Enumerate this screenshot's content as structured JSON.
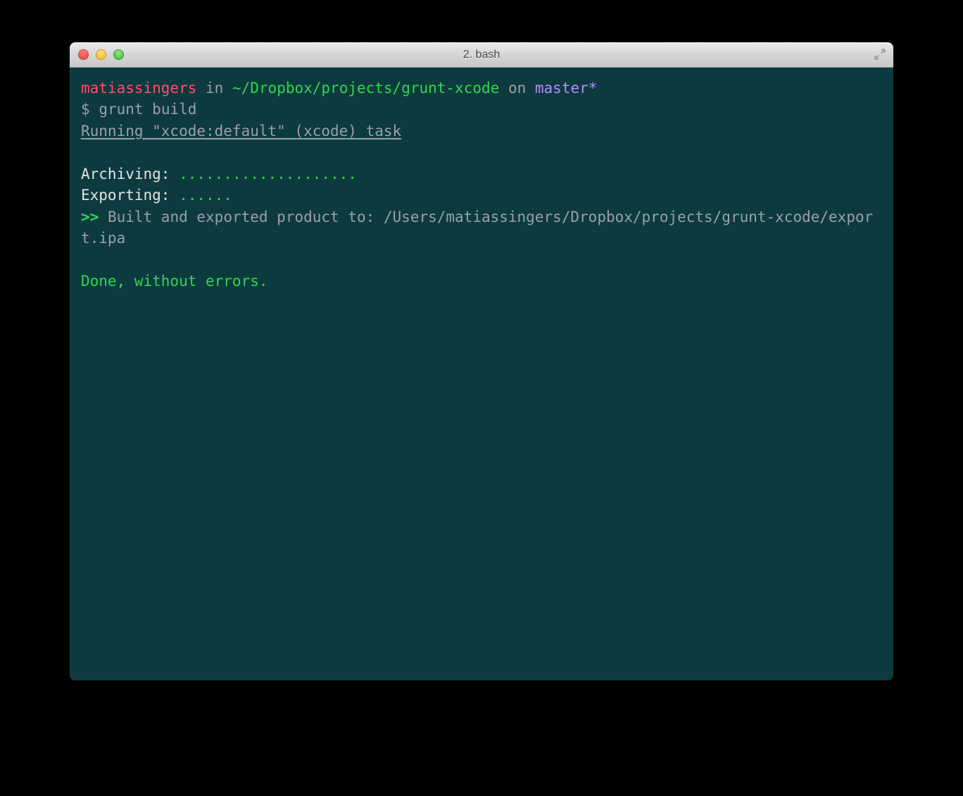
{
  "window": {
    "title": "2. bash"
  },
  "prompt": {
    "user": "matiassingers",
    "in_word": "in",
    "path": "~/Dropbox/projects/grunt-xcode",
    "on_word": "on",
    "branch": "master*",
    "dollar": "$",
    "command": "grunt build"
  },
  "output": {
    "running_task": "Running \"xcode:default\" (xcode) task",
    "archiving_label": "Archiving:",
    "archiving_dots": "....................",
    "exporting_label": "Exporting:",
    "exporting_dots": "......",
    "arrow": ">>",
    "built_msg": "Built and exported product to: /Users/matiassingers/Dropbox/projects/grunt-xcode/export.ipa",
    "done": "Done, without errors."
  }
}
